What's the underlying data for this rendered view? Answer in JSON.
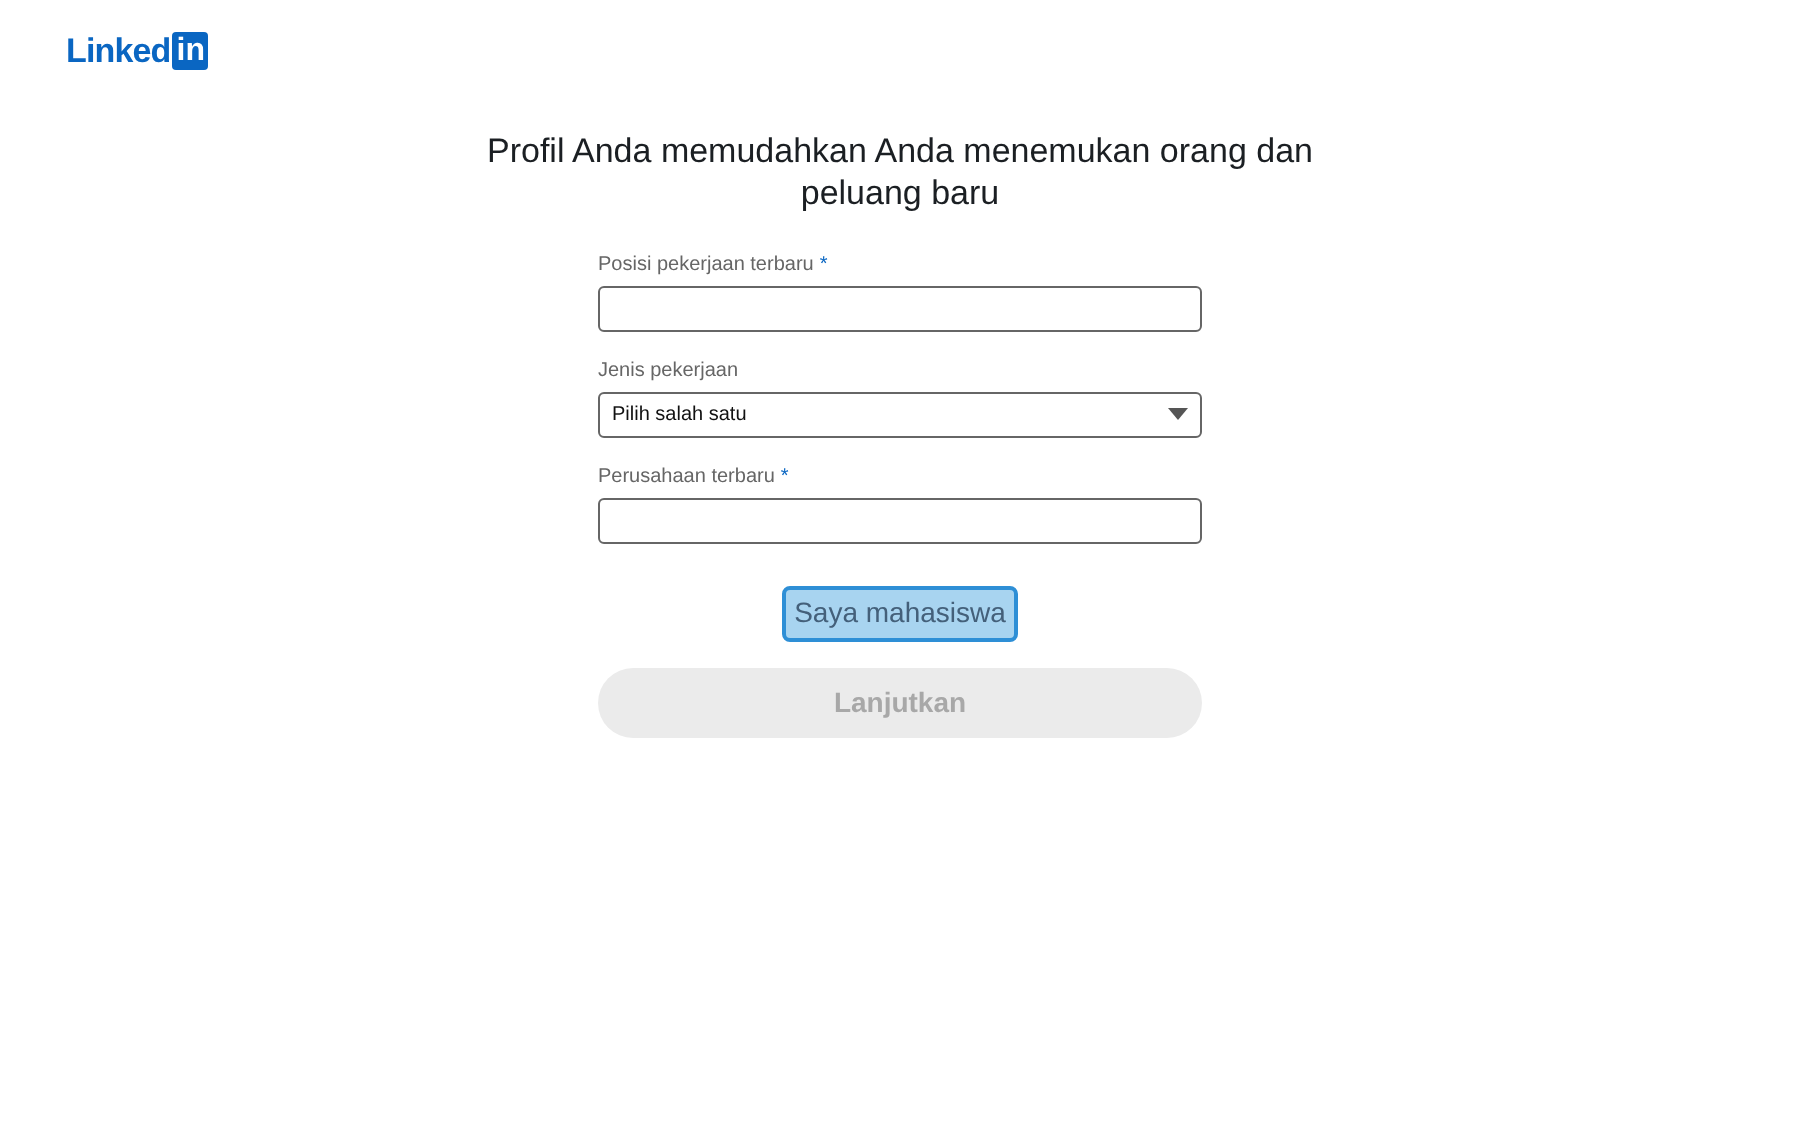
{
  "logo": {
    "word": "Linked",
    "badge": "in"
  },
  "heading": "Profil Anda memudahkan Anda menemukan orang dan peluang baru",
  "fields": [
    {
      "kind": "text",
      "label": "Posisi pekerjaan terbaru",
      "required_mark": "*"
    },
    {
      "kind": "select",
      "label": "Jenis pekerjaan",
      "value": "Pilih salah satu"
    },
    {
      "kind": "text",
      "label": "Perusahaan terbaru",
      "required_mark": "*"
    }
  ],
  "student_button": {
    "label": "Saya mahasiswa",
    "focused": true
  },
  "continue_button": {
    "label": "Lanjutkan",
    "disabled": true
  }
}
